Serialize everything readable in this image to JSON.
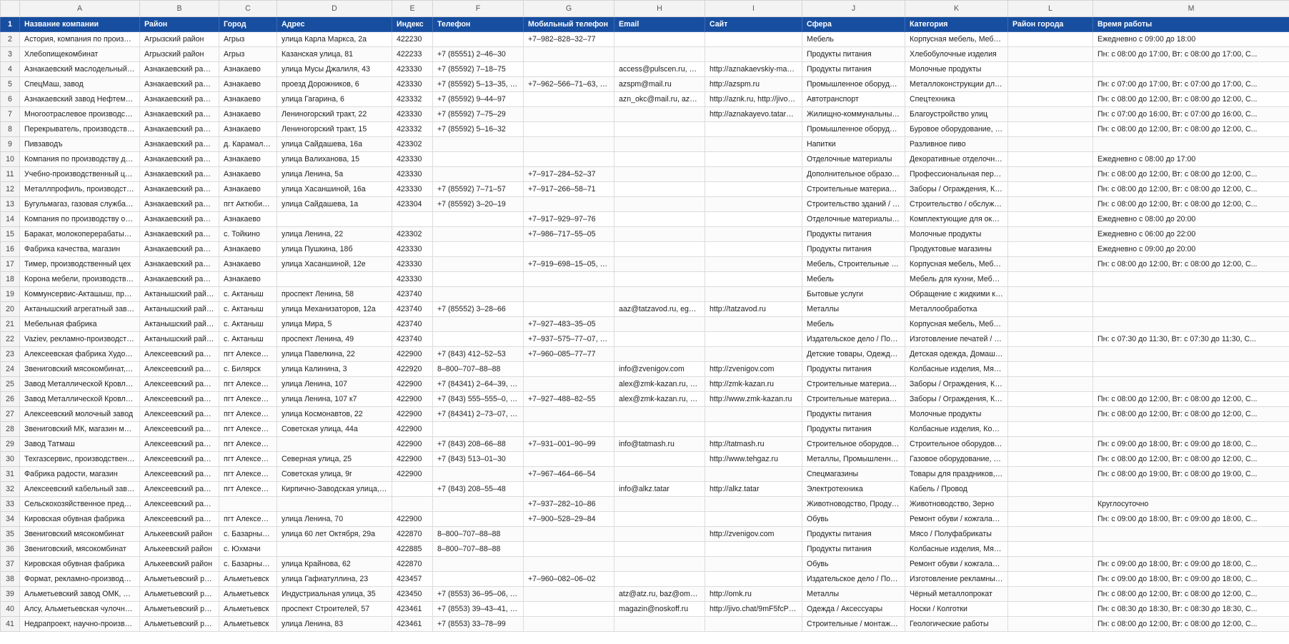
{
  "columns": [
    "A",
    "B",
    "C",
    "D",
    "E",
    "F",
    "G",
    "H",
    "I",
    "J",
    "K",
    "L",
    "M"
  ],
  "header_row_number": "1",
  "headers": [
    "Название компании",
    "Район",
    "Город",
    "Адрес",
    "Индекс",
    "Телефон",
    "Мобильный телефон",
    "Email",
    "Сайт",
    "Сфера",
    "Категория",
    "Район города",
    "Время работы"
  ],
  "rows": [
    {
      "n": "2",
      "c": [
        "Астория, компания по производству ...",
        "Агрызский район",
        "Агрыз",
        "улица Карла Маркса, 2а",
        "422230",
        "",
        "+7‒982‒828‒32‒77",
        "",
        "",
        "Мебель",
        "Корпусная мебель, Мебел...",
        "",
        "Ежедневно с 09:00 до 18:00"
      ]
    },
    {
      "n": "3",
      "c": [
        "Хлебопищекомбинат",
        "Агрызский район",
        "Агрыз",
        "Казанская улица, 81",
        "422233",
        "+7 (85551) 2‒46‒30",
        "",
        "",
        "",
        "Продукты питания",
        "Хлебобулочные изделия",
        "",
        "Пн: с 08:00 до 17:00, Вт: с 08:00 до 17:00, С..."
      ]
    },
    {
      "n": "4",
      "c": [
        "Азнакаевский маслодельный завод",
        "Азнакаевский район",
        "Азнакаево",
        "улица Мусы Джалиля, 43",
        "423330",
        "+7 (85592) 7‒18‒75",
        "",
        "access@pulscen.ru, amz...",
        "http://aznakaevskiy-maslo...",
        "Продукты питания",
        "Молочные продукты",
        "",
        ""
      ]
    },
    {
      "n": "5",
      "c": [
        "СпецМаш, завод",
        "Азнакаевский район",
        "Азнакаево",
        "проезд Дорожников, 6",
        "423330",
        "+7 (85592) 5‒13‒35, +7...",
        "+7‒962‒566‒71‒63, +7...",
        "azspm@mail.ru",
        "http://azspm.ru",
        "Промышленное оборудов...",
        "Металлоконструкции для ...",
        "",
        "Пн: с 07:00 до 17:00, Вт: с 07:00 до 17:00, С..."
      ]
    },
    {
      "n": "6",
      "c": [
        "Азнакаевский завод Нефтемаш",
        "Азнакаевский район",
        "Азнакаево",
        "улица Гагарина, 6",
        "423332",
        "+7 (85592) 9‒44‒97",
        "",
        "azn_okc@mail.ru, azn10...",
        "http://aznk.ru, http://jivo.c...",
        "Автотранспорт",
        "Спецтехника",
        "",
        "Пн: с 08:00 до 12:00, Вт: с 08:00 до 12:00, С..."
      ]
    },
    {
      "n": "7",
      "c": [
        "Многоотраслевое производственное ...",
        "Азнакаевский район",
        "Азнакаево",
        "Лениногорский тракт, 22",
        "423330",
        "+7 (85592) 7‒75‒29",
        "",
        "",
        "http://aznakayevo.tatarsta...",
        "Жилищно-коммунальные ...",
        "Благоустройство улиц",
        "",
        "Пн: с 07:00 до 16:00, Вт: с 07:00 до 16:00, С..."
      ]
    },
    {
      "n": "8",
      "c": [
        "Перекрыватель, производственная к...",
        "Азнакаевский район",
        "Азнакаево",
        "Лениногорский тракт, 15",
        "423332",
        "+7 (85592) 5‒16‒32",
        "",
        "",
        "",
        "Промышленное оборудов...",
        "Буровое оборудование, Н...",
        "",
        "Пн: с 08:00 до 12:00, Вт: с 08:00 до 12:00, С..."
      ]
    },
    {
      "n": "9",
      "c": [
        "Пивзаводъ",
        "Азнакаевский район",
        "д. Карамалы-Елга",
        "улица Сайдашева, 16а",
        "423302",
        "",
        "",
        "",
        "",
        "Напитки",
        "Разливное пиво",
        "",
        ""
      ]
    },
    {
      "n": "10",
      "c": [
        "Компания по производству декорати...",
        "Азнакаевский район",
        "Азнакаево",
        "улица Валиханова, 15",
        "423330",
        "",
        "",
        "",
        "",
        "Отделочные материалы",
        "Декоративные отделочны...",
        "",
        "Ежедневно с 08:00 до 17:00"
      ]
    },
    {
      "n": "11",
      "c": [
        "Учебно-производственный центр",
        "Азнакаевский район",
        "Азнакаево",
        "улица Ленина, 5а",
        "423330",
        "",
        "+7‒917‒284‒52‒37",
        "",
        "",
        "Дополнительное образов...",
        "Профессиональная перепо...",
        "",
        "Пн: с 08:00 до 12:00, Вт: с 08:00 до 12:00, С..."
      ]
    },
    {
      "n": "12",
      "c": [
        "Металлпрофиль, производственная ф...",
        "Азнакаевский район",
        "Азнакаево",
        "улица Хасаншиной, 16а",
        "423330",
        "+7 (85592) 7‒71‒57",
        "+7‒917‒266‒58‒71",
        "",
        "",
        "Строительные материалы ...",
        "Заборы / Ограждения, Кр...",
        "",
        "Пн: с 08:00 до 12:00, Вт: с 08:00 до 12:00, С..."
      ]
    },
    {
      "n": "13",
      "c": [
        "Бугульмагаз, газовая служба эксплуат...",
        "Азнакаевский район",
        "пгт Актюбинский",
        "улица Сайдашева, 1а",
        "423304",
        "+7 (85592) 3‒20‒19",
        "",
        "",
        "",
        "Строительство зданий / со...",
        "Строительство / обслужив...",
        "",
        "Пн: с 08:00 до 12:00, Вт: с 08:00 до 12:00, С..."
      ]
    },
    {
      "n": "14",
      "c": [
        "Компания по производству окон и ди...",
        "Азнакаевский район",
        "Азнакаево",
        "",
        "",
        "",
        "+7‒917‒929‒97‒76",
        "",
        "",
        "Отделочные материалы, С...",
        "Комплектующие для окон...",
        "",
        "Ежедневно с 08:00 до 20:00"
      ]
    },
    {
      "n": "15",
      "c": [
        "Баракат, молокоперерабатывающий ...",
        "Азнакаевский район",
        "с. Тойкино",
        "улица Ленина, 22",
        "423302",
        "",
        "+7‒986‒717‒55‒05",
        "",
        "",
        "Продукты питания",
        "Молочные продукты",
        "",
        "Ежедневно с 06:00 до 22:00"
      ]
    },
    {
      "n": "16",
      "c": [
        "Фабрика качества, магазин",
        "Азнакаевский район",
        "Азнакаево",
        "улица Пушкина, 18б",
        "423330",
        "",
        "",
        "",
        "",
        "Продукты питания",
        "Продуктовые магазины",
        "",
        "Ежедневно с 09:00 до 20:00"
      ]
    },
    {
      "n": "17",
      "c": [
        "Тимер, производственный цех",
        "Азнакаевский район",
        "Азнакаево",
        "улица Хасаншиной, 12е",
        "423330",
        "",
        "+7‒919‒698‒15‒05, +7...",
        "",
        "",
        "Мебель, Строительные ма...",
        "Корпусная мебель, Мебел...",
        "",
        "Пн: с 08:00 до 12:00, Вт: с 08:00 до 12:00, С..."
      ]
    },
    {
      "n": "18",
      "c": [
        "Корона мебели, производственная м...",
        "Азнакаевский район",
        "Азнакаево",
        "",
        "423330",
        "",
        "",
        "",
        "",
        "Мебель",
        "Мебель для кухни, Мебель...",
        "",
        ""
      ]
    },
    {
      "n": "19",
      "c": [
        "Коммунсервис-Акташыш, производст...",
        "Актанышский район",
        "с. Актаныш",
        "проспект Ленина, 58",
        "423740",
        "",
        "",
        "",
        "",
        "Бытовые услуги",
        "Обращение с жидкими ко...",
        "",
        ""
      ]
    },
    {
      "n": "20",
      "c": [
        "Актанышский агрегатный завод",
        "Актанышский район",
        "с. Актаныш",
        "улица Механизаторов, 12а",
        "423740",
        "+7 (85552) 3‒28‒66",
        "",
        "aaz@tatzavod.ru, egoro...",
        "http://tatzavod.ru",
        "Металлы",
        "Металлообработка",
        "",
        ""
      ]
    },
    {
      "n": "21",
      "c": [
        "Мебельная фабрика",
        "Актанышский район",
        "с. Актаныш",
        "улица Мира, 5",
        "423740",
        "",
        "+7‒927‒483‒35‒05",
        "",
        "",
        "Мебель",
        "Корпусная мебель, Мебел...",
        "",
        ""
      ]
    },
    {
      "n": "22",
      "c": [
        "Vaziev, рекламно-производственный ...",
        "Актанышский район",
        "с. Актаныш",
        "проспект Ленина, 49",
        "423740",
        "",
        "+7‒937‒575‒77‒07, +7...",
        "",
        "",
        "Издательское дело / Поли...",
        "Изготовление печатей / ш...",
        "",
        "Пн: с 07:30 до 11:30, Вт: с 07:30 до 11:30, С..."
      ]
    },
    {
      "n": "23",
      "c": [
        "Алексеевская фабрика Художественн...",
        "Алексеевский район",
        "пгт Алексеевское",
        "улица Павелкина, 22",
        "422900",
        "+7 (843) 412‒52‒53",
        "+7‒960‒085‒77‒77",
        "",
        "",
        "Детские товары, Одежда / ...",
        "Детская одежда, Домашни...",
        "",
        ""
      ]
    },
    {
      "n": "24",
      "c": [
        "Звениговский мясокомбинат, фирме...",
        "Алексеевский район",
        "с. Билярск",
        "улица Калинина, 3",
        "422920",
        "8‒800‒707‒88‒88",
        "",
        "info@zvenigov.com",
        "http://zvenigov.com",
        "Продукты питания",
        "Колбасные изделия, Мясо...",
        "",
        ""
      ]
    },
    {
      "n": "25",
      "c": [
        "Завод Металлической Кровли, компа...",
        "Алексеевский район",
        "пгт Алексеевское",
        "улица Ленина, 107",
        "422900",
        "+7 (84341) 2‒64‒39, +7...",
        "",
        "alex@zmk-kazan.ru, chi...",
        "http://zmk-kazan.ru",
        "Строительные материалы ...",
        "Заборы / Ограждения, Кр...",
        "",
        ""
      ]
    },
    {
      "n": "26",
      "c": [
        "Завод Металлической Кровли, компа...",
        "Алексеевский район",
        "пгт Алексеевское",
        "улица Ленина, 107 к7",
        "422900",
        "+7 (843) 555‒555‒0, +7...",
        "+7‒927‒488‒82‒55",
        "alex@zmk-kazan.ru, chi...",
        "http://www.zmk-kazan.ru",
        "Строительные материалы ...",
        "Заборы / Ограждения, Кр...",
        "",
        "Пн: с 08:00 до 12:00, Вт: с 08:00 до 12:00, С..."
      ]
    },
    {
      "n": "27",
      "c": [
        "Алексеевский молочный завод",
        "Алексеевский район",
        "пгт Алексеевское",
        "улица Космонавтов, 22",
        "422900",
        "+7 (84341) 2‒73‒07, +7...",
        "",
        "",
        "",
        "Продукты питания",
        "Молочные продукты",
        "",
        "Пн: с 08:00 до 12:00, Вт: с 08:00 до 12:00, С..."
      ]
    },
    {
      "n": "28",
      "c": [
        "Звениговский МК, магазин мяса и по...",
        "Алексеевский район",
        "пгт Алексеевское",
        "Советская улица, 44а",
        "422900",
        "",
        "",
        "",
        "",
        "Продукты питания",
        "Колбасные изделия, Конд...",
        "",
        ""
      ]
    },
    {
      "n": "29",
      "c": [
        "Завод Татмаш",
        "Алексеевский район",
        "пгт Алексеевское",
        "",
        "422900",
        "+7 (843) 208‒66‒88",
        "+7‒931‒001‒90‒99",
        "info@tatmash.ru",
        "http://tatmash.ru",
        "Строительное оборудован...",
        "Строительное оборудован...",
        "",
        "Пн: с 09:00 до 18:00, Вт: с 09:00 до 18:00, С..."
      ]
    },
    {
      "n": "30",
      "c": [
        "Техгазсервис, производственно-торг...",
        "Алексеевский район",
        "пгт Алексеевское",
        "Северная улица, 25",
        "422900",
        "+7 (843) 513‒01‒30",
        "",
        "",
        "http://www.tehgaz.ru",
        "Металлы, Промышленное ...",
        "Газовое оборудование, Не...",
        "",
        "Пн: с 08:00 до 12:00, Вт: с 08:00 до 12:00, С..."
      ]
    },
    {
      "n": "31",
      "c": [
        "Фабрика радости, магазин",
        "Алексеевский район",
        "пгт Алексеевское",
        "Советская улица, 9г",
        "422900",
        "",
        "+7‒967‒464‒66‒54",
        "",
        "",
        "Спецмагазины",
        "Товары для праздников, Ц...",
        "",
        "Пн: с 08:00 до 19:00, Вт: с 08:00 до 19:00, С..."
      ]
    },
    {
      "n": "32",
      "c": [
        "Алексеевский кабельный завод",
        "Алексеевский район",
        "пгт Алексеевское",
        "Кирпично-Заводская улица, 8а",
        "",
        "+7 (843) 208‒55‒48",
        "",
        "info@alkz.tatar",
        "http://alkz.tatar",
        "Электротехника",
        "Кабель / Провод",
        "",
        ""
      ]
    },
    {
      "n": "33",
      "c": [
        "Сельскохозяйственное предприятие ...",
        "Алексеевский район",
        "",
        "",
        "",
        "",
        "+7‒937‒282‒10‒86",
        "",
        "",
        "Животноводство, Продукт...",
        "Животноводство, Зерно",
        "",
        "Круглосуточно"
      ]
    },
    {
      "n": "34",
      "c": [
        "Кировская обувная фабрика",
        "Алексеевский район",
        "пгт Алексеевское",
        "улица Ленина, 70",
        "422900",
        "",
        "+7‒900‒528‒29‒84",
        "",
        "",
        "Обувь",
        "Ремонт обуви / кожгалант...",
        "",
        "Пн: с 09:00 до 18:00, Вт: с 09:00 до 18:00, С..."
      ]
    },
    {
      "n": "35",
      "c": [
        "Звениговский мясокомбинат",
        "Алькеевский район",
        "с. Базарные Ма...",
        "улица 60 лет Октября, 29а",
        "422870",
        "8‒800‒707‒88‒88",
        "",
        "",
        "http://zvenigov.com",
        "Продукты питания",
        "Мясо / Полуфабрикаты",
        "",
        ""
      ]
    },
    {
      "n": "36",
      "c": [
        "Звениговский, мясокомбинат",
        "Алькеевский район",
        "с. Юхмачи",
        "",
        "422885",
        "8‒800‒707‒88‒88",
        "",
        "",
        "",
        "Продукты питания",
        "Колбасные изделия, Мясо ...",
        "",
        ""
      ]
    },
    {
      "n": "37",
      "c": [
        "Кировская обувная фабрика",
        "Алькеевский район",
        "с. Базарные Ма...",
        "улица Крайнова, 62",
        "422870",
        "",
        "",
        "",
        "",
        "Обувь",
        "Ремонт обуви / кожгалант...",
        "",
        "Пн: с 09:00 до 18:00, Вт: с 09:00 до 18:00, С..."
      ]
    },
    {
      "n": "38",
      "c": [
        "Формат, рекламно-производственная...",
        "Альметьевский район",
        "Альметьевск",
        "улица Гафиатуллина, 23",
        "423457",
        "",
        "+7‒960‒082‒06‒02",
        "",
        "",
        "Издательское дело / Поли...",
        "Изготовление рекламных ...",
        "",
        "Пн: с 09:00 до 18:00, Вт: с 09:00 до 18:00, С..."
      ]
    },
    {
      "n": "39",
      "c": [
        "Альметьевский завод ОМК, филиал в ...",
        "Альметьевский район",
        "Альметьевск",
        "Индустриальная улица, 35",
        "423450",
        "+7 (8553) 36‒95‒06, +7...",
        "",
        "atz@atz.ru, baz@omk.r...",
        "http://omk.ru",
        "Металлы",
        "Чёрный металлопрокат",
        "",
        "Пн: с 08:00 до 12:00, Вт: с 08:00 до 12:00, С..."
      ]
    },
    {
      "n": "40",
      "c": [
        "Алсу, Альметьевская чулочно-носочн...",
        "Альметьевский район",
        "Альметьевск",
        "проспект Строителей, 57",
        "423461",
        "+7 (8553) 39‒43‒41, +7...",
        "",
        "magazin@noskoff.ru",
        "http://jivo.chat/9mF5fcPn...",
        "Одежда / Аксессуары",
        "Носки / Колготки",
        "",
        "Пн: с 08:30 до 18:30, Вт: с 08:30 до 18:30, С..."
      ]
    },
    {
      "n": "41",
      "c": [
        "Недрапроект, научно-производствен...",
        "Альметьевский район",
        "Альметьевск",
        "улица Ленина, 83",
        "423461",
        "+7 (8553) 33‒78‒99",
        "",
        "",
        "",
        "Строительные / монтажны...",
        "Геологические работы",
        "",
        "Пн: с 08:00 до 12:00, Вт: с 08:00 до 12:00, С..."
      ]
    }
  ]
}
